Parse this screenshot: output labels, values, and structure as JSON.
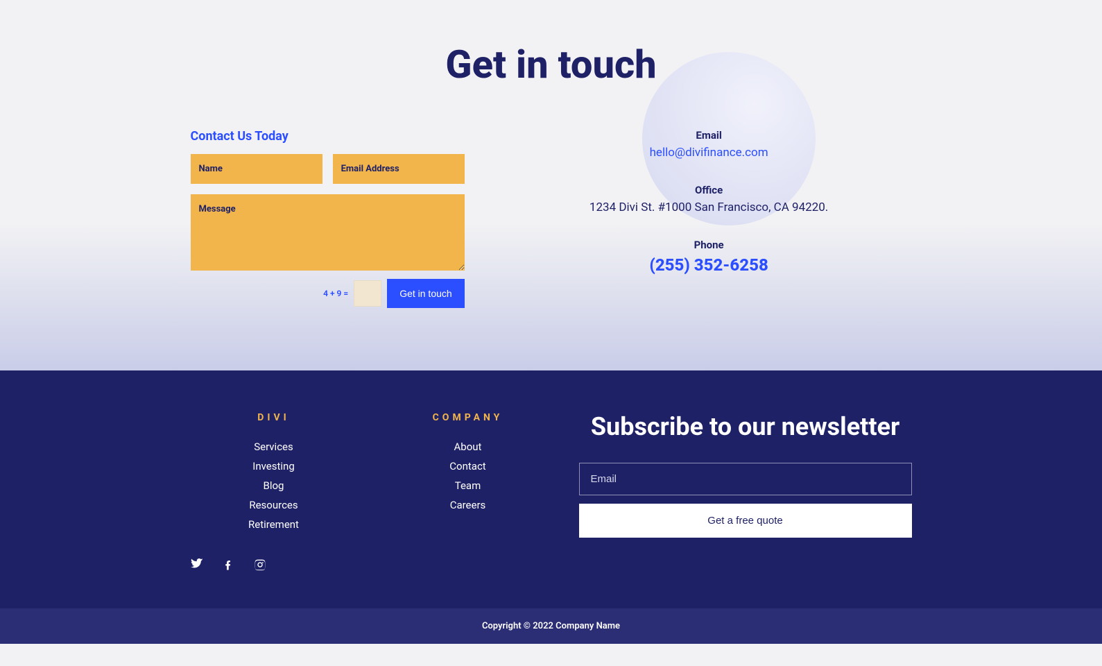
{
  "hero": {
    "title": "Get in touch"
  },
  "form": {
    "heading": "Contact Us Today",
    "name_ph": "Name",
    "email_ph": "Email Address",
    "message_ph": "Message",
    "captcha": "4 + 9 =",
    "submit": "Get in touch"
  },
  "contact": {
    "email_label": "Email",
    "email_value": "hello@divifinance.com",
    "office_label": "Office",
    "office_value": "1234 Divi St. #1000 San Francisco, CA 94220.",
    "phone_label": "Phone",
    "phone_value": "(255) 352-6258"
  },
  "footer": {
    "col1": {
      "heading": "DIVI",
      "items": [
        "Services",
        "Investing",
        "Blog",
        "Resources",
        "Retirement"
      ]
    },
    "col2": {
      "heading": "COMPANY",
      "items": [
        "About",
        "Contact",
        "Team",
        "Careers"
      ]
    },
    "newsletter": {
      "title": "Subscribe to our newsletter",
      "email_ph": "Email",
      "button": "Get a free quote"
    },
    "copyright": "Copyright © 2022 Company Name"
  }
}
